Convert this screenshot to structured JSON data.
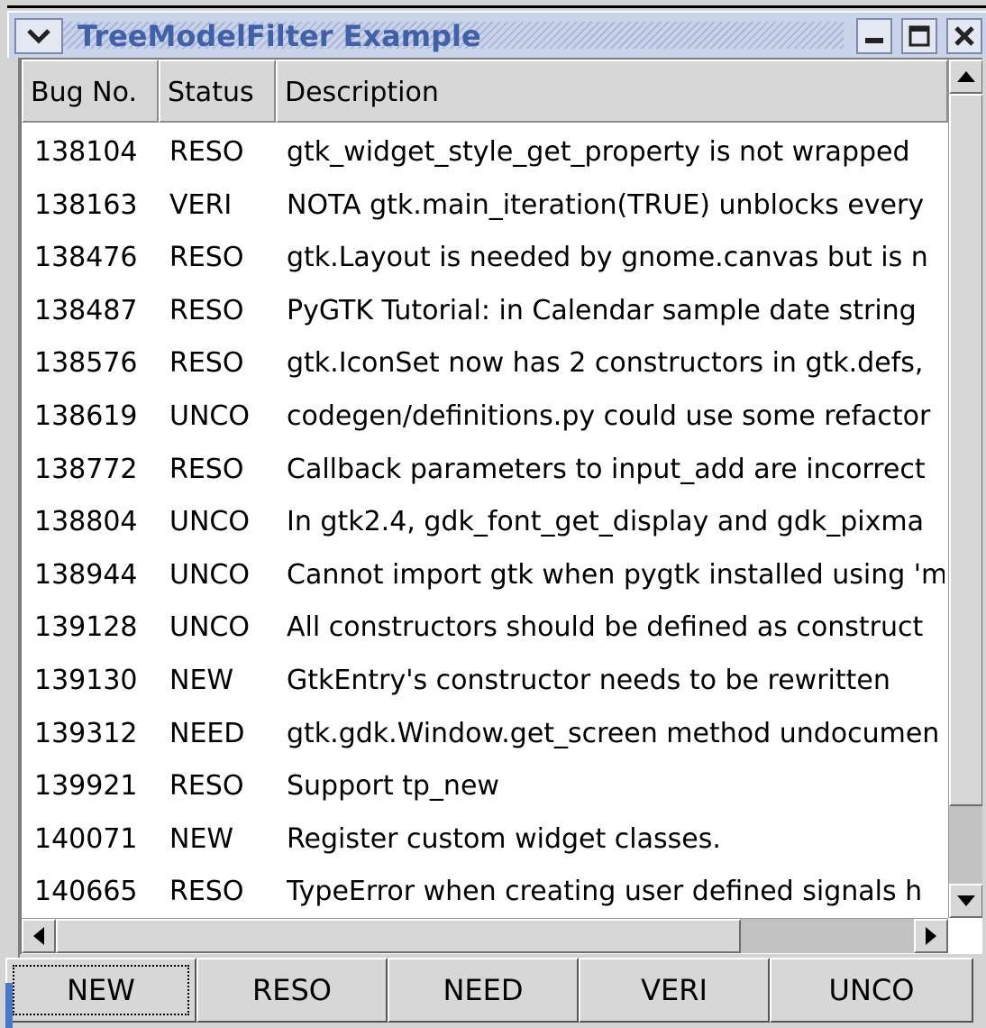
{
  "window": {
    "title": "TreeModelFilter Example"
  },
  "table": {
    "columns": [
      "Bug No.",
      "Status",
      "Description"
    ],
    "rows": [
      {
        "bug": "138104",
        "status": "RESO",
        "desc": "gtk_widget_style_get_property is not wrapped"
      },
      {
        "bug": "138163",
        "status": "VERI",
        "desc": "NOTA gtk.main_iteration(TRUE) unblocks every"
      },
      {
        "bug": "138476",
        "status": "RESO",
        "desc": "gtk.Layout is needed by gnome.canvas but is n"
      },
      {
        "bug": "138487",
        "status": "RESO",
        "desc": "PyGTK Tutorial: in Calendar sample date string"
      },
      {
        "bug": "138576",
        "status": "RESO",
        "desc": "gtk.IconSet now has 2 constructors in gtk.defs,"
      },
      {
        "bug": "138619",
        "status": "UNCO",
        "desc": "codegen/definitions.py could use some refactor"
      },
      {
        "bug": "138772",
        "status": "RESO",
        "desc": "Callback parameters to input_add are incorrect"
      },
      {
        "bug": "138804",
        "status": "UNCO",
        "desc": "In gtk2.4, gdk_font_get_display and gdk_pixma"
      },
      {
        "bug": "138944",
        "status": "UNCO",
        "desc": "Cannot import gtk when pygtk installed using 'm"
      },
      {
        "bug": "139128",
        "status": "UNCO",
        "desc": "All constructors should be defined as construct"
      },
      {
        "bug": "139130",
        "status": "NEW",
        "desc": "GtkEntry's constructor needs to be rewritten"
      },
      {
        "bug": "139312",
        "status": "NEED",
        "desc": "gtk.gdk.Window.get_screen method undocumen"
      },
      {
        "bug": "139921",
        "status": "RESO",
        "desc": "Support tp_new"
      },
      {
        "bug": "140071",
        "status": "NEW",
        "desc": "Register custom widget classes."
      },
      {
        "bug": "140665",
        "status": "RESO",
        "desc": "TypeError when creating user defined signals h"
      }
    ]
  },
  "filter_buttons": [
    "NEW",
    "RESO",
    "NEED",
    "VERI",
    "UNCO"
  ],
  "icons": {
    "window_menu": "chevron-down-icon",
    "minimize": "minimize-icon",
    "maximize": "maximize-icon",
    "close": "close-icon",
    "scroll_up": "arrow-up-icon",
    "scroll_down": "arrow-down-icon",
    "scroll_left": "arrow-left-icon",
    "scroll_right": "arrow-right-icon"
  }
}
